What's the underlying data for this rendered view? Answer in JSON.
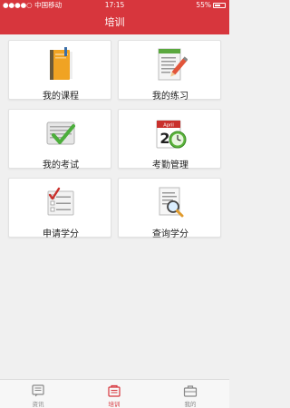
{
  "status": {
    "carrier": "●●●●○ 中国移动",
    "time": "17:15",
    "battery": "55%"
  },
  "nav": {
    "title": "培训"
  },
  "tiles": [
    {
      "label": "我的课程",
      "icon": "book-icon"
    },
    {
      "label": "我的练习",
      "icon": "notepad-pencil-icon"
    },
    {
      "label": "我的考试",
      "icon": "exam-check-icon"
    },
    {
      "label": "考勤管理",
      "icon": "calendar-clock-icon"
    },
    {
      "label": "申请学分",
      "icon": "checklist-icon"
    },
    {
      "label": "查询学分",
      "icon": "document-search-icon"
    }
  ],
  "tabs": [
    {
      "label": "资讯",
      "icon": "news-icon",
      "active": false
    },
    {
      "label": "培训",
      "icon": "training-icon",
      "active": true
    },
    {
      "label": "我的",
      "icon": "briefcase-icon",
      "active": false
    }
  ],
  "colors": {
    "brand": "#d7363d",
    "tab_inactive": "#888888"
  },
  "calendar_icon_text": {
    "month": "April",
    "day": "2"
  }
}
